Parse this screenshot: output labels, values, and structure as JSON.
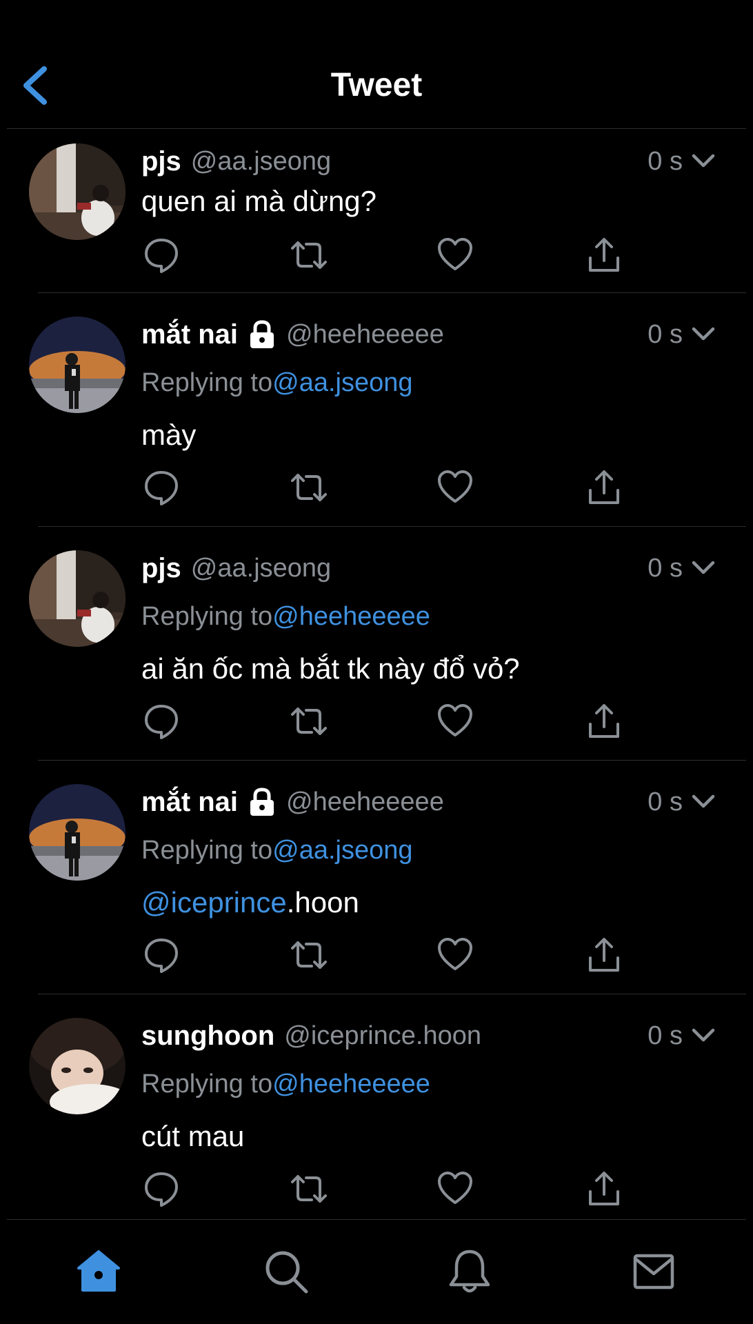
{
  "header": {
    "title": "Tweet",
    "back_icon": "chevron-left-icon"
  },
  "colors": {
    "background": "#000000",
    "accent": "#3f91e0",
    "secondary_text": "#8b9096",
    "divider": "#2b2e32"
  },
  "tweets": [
    {
      "display_name": "pjs",
      "locked": false,
      "handle": "@aa.jseong",
      "time": "0 s",
      "replying_prefix": "",
      "replying_to": "",
      "text_mention": "",
      "text": "quen ai mà dừng?"
    },
    {
      "display_name": "mắt nai",
      "locked": true,
      "handle": "@heeheeeee",
      "time": "0 s",
      "replying_prefix": "Replying to",
      "replying_to": "@aa.jseong",
      "text_mention": "",
      "text": "mày"
    },
    {
      "display_name": "pjs",
      "locked": false,
      "handle": "@aa.jseong",
      "time": "0 s",
      "replying_prefix": "Replying to",
      "replying_to": "@heeheeeee",
      "text_mention": "",
      "text": "ai ăn ốc mà bắt tk này đổ vỏ?"
    },
    {
      "display_name": "mắt nai",
      "locked": true,
      "handle": "@heeheeeee",
      "time": "0 s",
      "replying_prefix": "Replying to",
      "replying_to": "@aa.jseong",
      "text_mention": "@iceprince",
      "text": ".hoon"
    },
    {
      "display_name": "sunghoon",
      "locked": false,
      "handle": "@iceprince.hoon",
      "time": "0 s",
      "replying_prefix": "Replying to",
      "replying_to": "@heeheeeee",
      "text_mention": "",
      "text": "cút mau"
    }
  ],
  "actions": [
    "reply-icon",
    "retweet-icon",
    "like-icon",
    "share-icon"
  ],
  "tabbar": {
    "tabs": [
      {
        "icon": "home-icon",
        "active": true
      },
      {
        "icon": "search-icon",
        "active": false
      },
      {
        "icon": "bell-icon",
        "active": false
      },
      {
        "icon": "mail-icon",
        "active": false
      }
    ]
  }
}
